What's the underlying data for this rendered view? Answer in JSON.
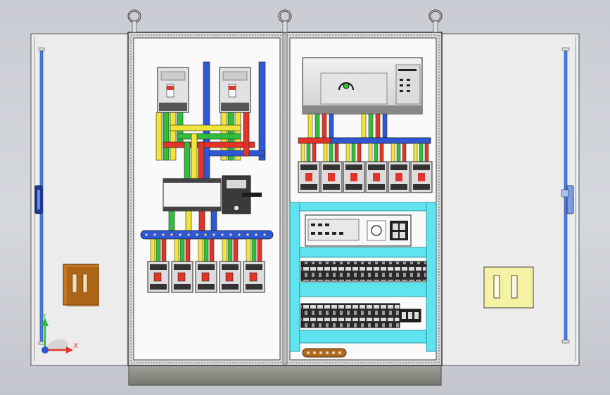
{
  "view": {
    "name": "electrical-cabinet-3d-view",
    "triad": {
      "x_label": "X",
      "y_label": "Y"
    }
  },
  "colors": {
    "background": "#cfd2d8",
    "panel": "#f4f4f4",
    "door": "#ececec",
    "frame": "#6d6d6d",
    "bus_blue": "#2f58d6",
    "bus_yellow": "#f1e43a",
    "bus_green": "#2fbf3a",
    "bus_red": "#e3342a",
    "duct_cyan": "#5fe3ee",
    "hinge_brown": "#b06a1d",
    "hinge_yellow": "#f4f09a",
    "base": "#8f8f8a"
  },
  "icons": {
    "lifting_eye": "lifting-eye-icon",
    "door_handle": "door-handle-icon",
    "lock": "lock-icon"
  }
}
